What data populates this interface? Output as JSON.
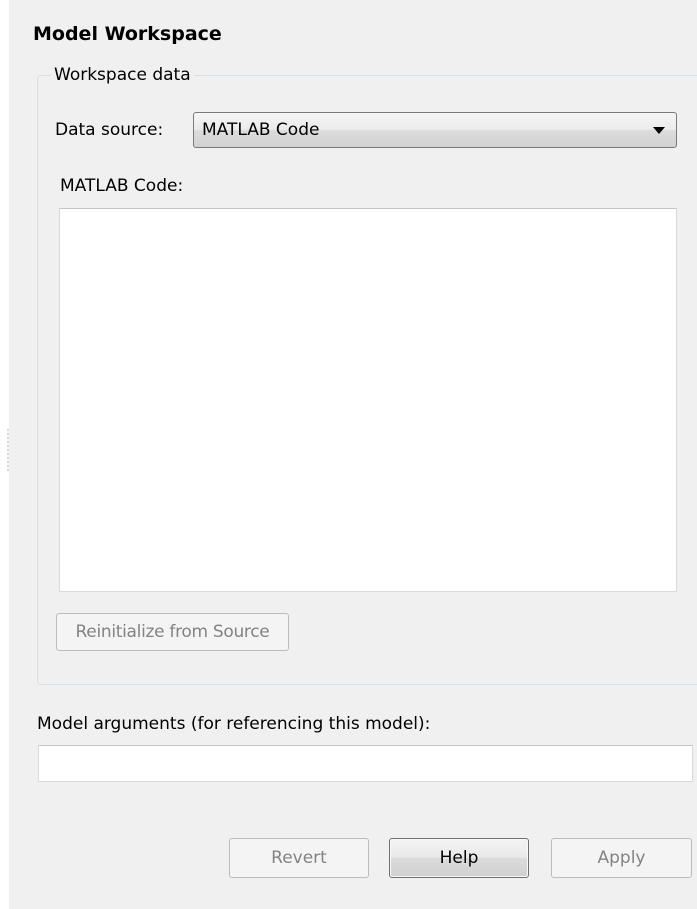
{
  "title": "Model Workspace",
  "workspace_group": {
    "legend": "Workspace data",
    "data_source_label": "Data source:",
    "data_source_value": "MATLAB Code",
    "code_label": "MATLAB Code:",
    "code_value": "",
    "reinitialize_label": "Reinitialize from Source"
  },
  "model_arguments": {
    "label": "Model arguments (for referencing this model):",
    "value": ""
  },
  "buttons": {
    "revert": "Revert",
    "help": "Help",
    "apply": "Apply"
  },
  "icons": {
    "dropdown": "chevron-down-icon"
  },
  "colors": {
    "panel_background": "#f0f0f0",
    "disabled_text": "#838383"
  }
}
